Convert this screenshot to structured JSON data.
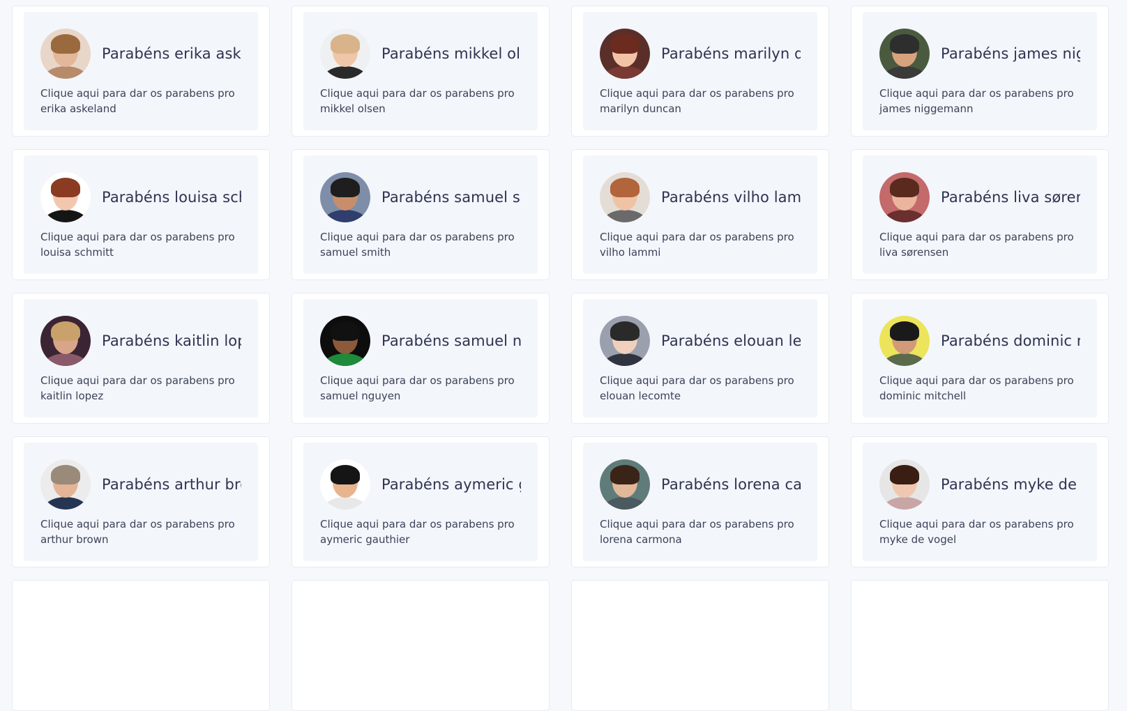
{
  "cards": [
    {
      "title": "Parabéns erika askeland",
      "desc_prefix": "Clique aqui para dar os parabens pro",
      "name": "erika askeland",
      "colors": {
        "bg": "#e8d6c9",
        "skin": "#e2b79a",
        "hair": "#9a6a3e",
        "shirt": "#b78a6a"
      }
    },
    {
      "title": "Parabéns mikkel olsen",
      "desc_prefix": "Clique aqui para dar os parabens pro",
      "name": "mikkel olsen",
      "colors": {
        "bg": "#eef0f2",
        "skin": "#f0c6a8",
        "hair": "#d9b48a",
        "shirt": "#2a2a2a"
      }
    },
    {
      "title": "Parabéns marilyn duncan",
      "desc_prefix": "Clique aqui para dar os parabens pro",
      "name": "marilyn duncan",
      "colors": {
        "bg": "#5a2f2a",
        "skin": "#f2c3a6",
        "hair": "#6b2b1e",
        "shirt": "#7a3a33"
      }
    },
    {
      "title": "Parabéns james niggemann",
      "desc_prefix": "Clique aqui para dar os parabens pro",
      "name": "james niggemann",
      "colors": {
        "bg": "#4a5a3e",
        "skin": "#d8a27c",
        "hair": "#2e2e2e",
        "shirt": "#3a3a3a"
      }
    },
    {
      "title": "Parabéns louisa schmitt",
      "desc_prefix": "Clique aqui para dar os parabens pro",
      "name": "louisa schmitt",
      "colors": {
        "bg": "#ffffff",
        "skin": "#f3c7ae",
        "hair": "#8a3b22",
        "shirt": "#151515"
      }
    },
    {
      "title": "Parabéns samuel smith",
      "desc_prefix": "Clique aqui para dar os parabens pro",
      "name": "samuel smith",
      "colors": {
        "bg": "#7f8ea8",
        "skin": "#c88e6b",
        "hair": "#1e1e1e",
        "shirt": "#2f3e6c"
      }
    },
    {
      "title": "Parabéns vilho lammi",
      "desc_prefix": "Clique aqui para dar os parabens pro",
      "name": "vilho lammi",
      "colors": {
        "bg": "#e3ddd6",
        "skin": "#efc3a4",
        "hair": "#b2643a",
        "shirt": "#6a6a6a"
      }
    },
    {
      "title": "Parabéns liva sørensen",
      "desc_prefix": "Clique aqui para dar os parabens pro",
      "name": "liva sørensen",
      "colors": {
        "bg": "#c46a6a",
        "skin": "#eab59c",
        "hair": "#5a2a1e",
        "shirt": "#6a2f2f"
      }
    },
    {
      "title": "Parabéns kaitlin lopez",
      "desc_prefix": "Clique aqui para dar os parabens pro",
      "name": "kaitlin lopez",
      "colors": {
        "bg": "#3b2433",
        "skin": "#d8a48a",
        "hair": "#c9a16a",
        "shirt": "#8a5a6a"
      }
    },
    {
      "title": "Parabéns samuel nguyen",
      "desc_prefix": "Clique aqui para dar os parabens pro",
      "name": "samuel nguyen",
      "colors": {
        "bg": "#0d0d0d",
        "skin": "#8a5a3a",
        "hair": "#111111",
        "shirt": "#1e8a3a"
      }
    },
    {
      "title": "Parabéns elouan lecomte",
      "desc_prefix": "Clique aqui para dar os parabens pro",
      "name": "elouan lecomte",
      "colors": {
        "bg": "#9aa0ad",
        "skin": "#f0d0bc",
        "hair": "#2a2a2a",
        "shirt": "#2f3440"
      }
    },
    {
      "title": "Parabéns dominic mitchell",
      "desc_prefix": "Clique aqui para dar os parabens pro",
      "name": "dominic mitchell",
      "colors": {
        "bg": "#ece45a",
        "skin": "#d29a78",
        "hair": "#1a1a1a",
        "shirt": "#5a6a4a"
      }
    },
    {
      "title": "Parabéns arthur brown",
      "desc_prefix": "Clique aqui para dar os parabens pro",
      "name": "arthur brown",
      "colors": {
        "bg": "#ececec",
        "skin": "#e4b496",
        "hair": "#9a8a7a",
        "shirt": "#253552"
      }
    },
    {
      "title": "Parabéns aymeric gauthier",
      "desc_prefix": "Clique aqui para dar os parabens pro",
      "name": "aymeric gauthier",
      "colors": {
        "bg": "#ffffff",
        "skin": "#e8b48e",
        "hair": "#151515",
        "shirt": "#e8e8e8"
      }
    },
    {
      "title": "Parabéns lorena carmona",
      "desc_prefix": "Clique aqui para dar os parabens pro",
      "name": "lorena carmona",
      "colors": {
        "bg": "#5f7c7a",
        "skin": "#e2b89a",
        "hair": "#3a2418",
        "shirt": "#4a5a60"
      }
    },
    {
      "title": "Parabéns myke de vogel",
      "desc_prefix": "Clique aqui para dar os parabens pro",
      "name": "myke de vogel",
      "colors": {
        "bg": "#e6e6e6",
        "skin": "#f0c8b0",
        "hair": "#3a1e14",
        "shirt": "#c8a6a6"
      }
    },
    {
      "title": "",
      "desc_prefix": "",
      "name": "",
      "colors": {
        "bg": "#ffffff",
        "skin": "#ffffff",
        "hair": "#ffffff",
        "shirt": "#ffffff"
      }
    },
    {
      "title": "",
      "desc_prefix": "",
      "name": "",
      "colors": {
        "bg": "#ffffff",
        "skin": "#ffffff",
        "hair": "#ffffff",
        "shirt": "#ffffff"
      }
    },
    {
      "title": "",
      "desc_prefix": "",
      "name": "",
      "colors": {
        "bg": "#ffffff",
        "skin": "#ffffff",
        "hair": "#ffffff",
        "shirt": "#ffffff"
      }
    },
    {
      "title": "",
      "desc_prefix": "",
      "name": "",
      "colors": {
        "bg": "#ffffff",
        "skin": "#ffffff",
        "hair": "#ffffff",
        "shirt": "#ffffff"
      }
    }
  ]
}
